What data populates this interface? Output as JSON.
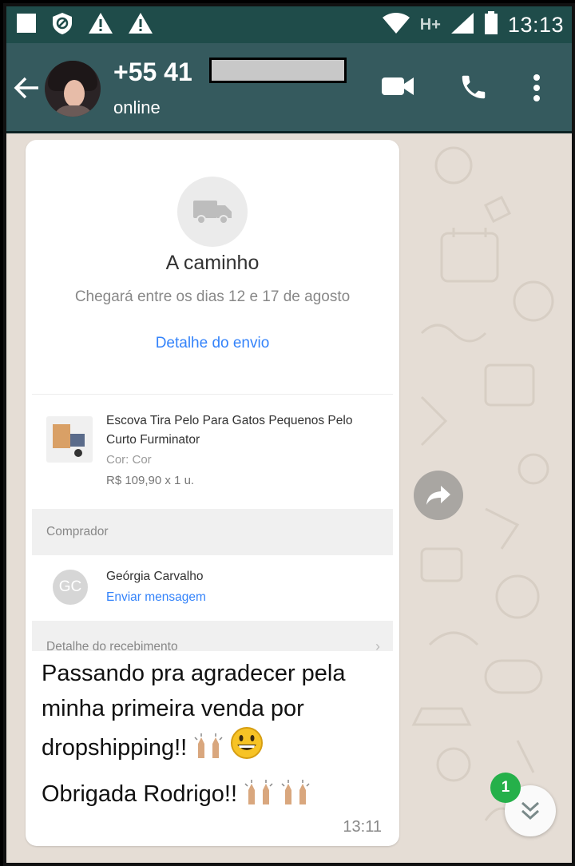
{
  "status_bar": {
    "time": "13:13",
    "network": "H+",
    "icons": [
      "stop-icon",
      "data-saver-icon",
      "warning-icon",
      "warning-icon",
      "wifi-icon",
      "signal-icon",
      "battery-icon"
    ]
  },
  "header": {
    "contact_name": "+55 41",
    "status": "online",
    "icons": [
      "back-arrow-icon",
      "video-call-icon",
      "phone-call-icon",
      "more-vert-icon"
    ]
  },
  "message": {
    "card": {
      "title": "A caminho",
      "subtitle": "Chegará entre os dias 12 e 17 de agosto",
      "link": "Detalhe do envio",
      "product": {
        "name": "Escova Tira Pelo Para Gatos Pequenos Pelo Curto Furminator",
        "color": "Cor: Cor",
        "price": "R$ 109,90 x 1 u."
      },
      "buyer_section": "Comprador",
      "buyer": {
        "initials": "GC",
        "name": "Geórgia Carvalho",
        "action": "Enviar mensagem"
      },
      "receipt_section": "Detalhe do recebimento"
    },
    "line1": "Passando pra agradecer pela minha primeira venda por dropshipping!!",
    "line2": "Obrigada Rodrigo!!",
    "time": "13:11"
  },
  "scroll": {
    "unread_count": "1"
  },
  "colors": {
    "status_bar": "#1f4c4a",
    "header": "#355a5e",
    "wallpaper": "#e5ddd5",
    "link": "#3483fa",
    "unread_badge": "#25b04a"
  }
}
